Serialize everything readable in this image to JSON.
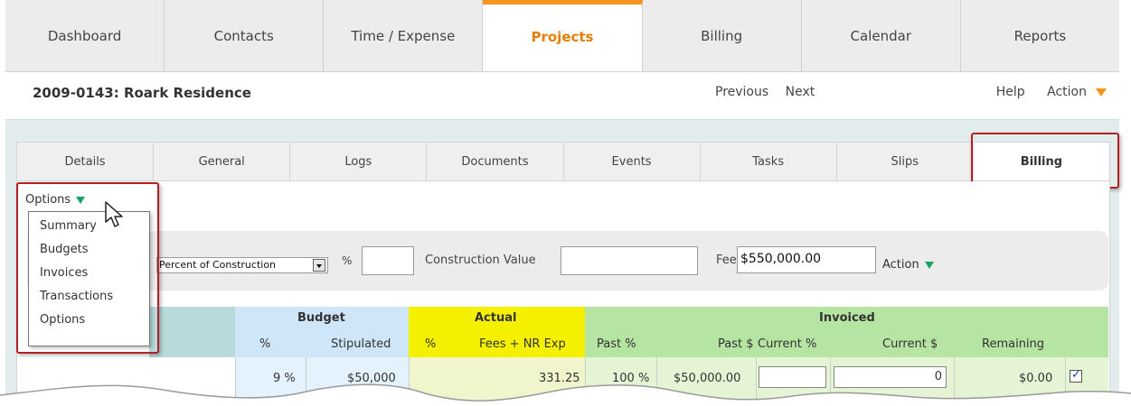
{
  "nav": {
    "tabs": [
      "Dashboard",
      "Contacts",
      "Time / Expense",
      "Projects",
      "Billing",
      "Calendar",
      "Reports"
    ],
    "active": "Projects"
  },
  "project": {
    "title": "2009-0143: Roark Residence",
    "previous": "Previous",
    "next": "Next",
    "help": "Help",
    "action": "Action"
  },
  "subtabs": [
    "Details",
    "General",
    "Logs",
    "Documents",
    "Events",
    "Tasks",
    "Slips",
    "Billing"
  ],
  "options": {
    "label": "Options",
    "menu": [
      "Summary",
      "Budgets",
      "Invoices",
      "Transactions",
      "Options"
    ]
  },
  "filter": {
    "method": "Percent of Construction",
    "pct_label": "%",
    "construction_value_label": "Construction Value",
    "fee_label": "Fee",
    "fee_value": "$550,000.00",
    "action": "Action"
  },
  "table": {
    "groups": {
      "budget": "Budget",
      "actual": "Actual",
      "invoiced": "Invoiced"
    },
    "columns": {
      "budget_pct": "%",
      "stipulated": "Stipulated",
      "actual_pct": "%",
      "fees_nr": "Fees + NR Exp",
      "past_pct": "Past %",
      "past_d": "Past $",
      "current_pct": "Current %",
      "current_d": "Current $",
      "remaining": "Remaining"
    },
    "row": {
      "budget_pct": "9 %",
      "stipulated": "$50,000",
      "fees_nr": "331.25",
      "past_pct": "100 %",
      "past_d": "$50,000.00",
      "current_d": "0",
      "remaining": "$0.00"
    }
  },
  "colors": {
    "accent": "#f7941e",
    "highlight_box": "#b22222",
    "budget": "#cfe6f8",
    "actual": "#f5f000",
    "invoiced": "#b5e4a3"
  }
}
